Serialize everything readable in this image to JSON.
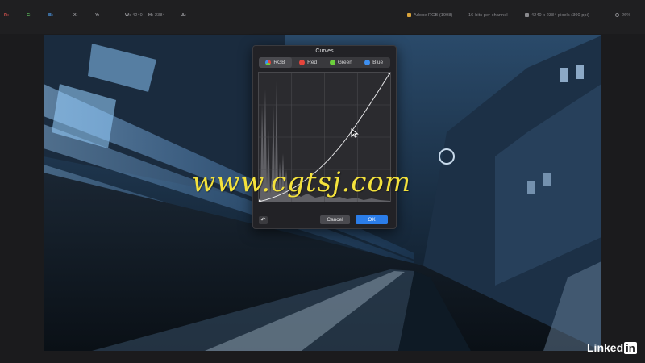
{
  "info_bar": {
    "r_label": "R:",
    "r_value": "-----",
    "g_label": "G:",
    "g_value": "-----",
    "b_label": "B:",
    "b_value": "-----",
    "x_label": "X:",
    "x_value": "-----",
    "y_label": "Y:",
    "y_value": "-----",
    "w_label": "W:",
    "w_value": "4240",
    "h_label": "H:",
    "h_value": "2384",
    "delta_label": "Δ:",
    "delta_value": "-----",
    "color_profile": "Adobe RGB (1998)",
    "bit_depth": "16-bits per channel",
    "dimensions": "4240 x 2384 pixels (300 ppi)",
    "zoom": "26%"
  },
  "curves_dialog": {
    "title": "Curves",
    "tabs": [
      {
        "label": "RGB",
        "color": "rgb-wheel",
        "active": true
      },
      {
        "label": "Red",
        "color": "#e5453c",
        "active": false
      },
      {
        "label": "Green",
        "color": "#6ccf3d",
        "active": false
      },
      {
        "label": "Blue",
        "color": "#3e8ff0",
        "active": false
      }
    ],
    "reset_icon": "undo-icon",
    "cancel_label": "Cancel",
    "ok_label": "OK"
  },
  "watermark": "www.cgtsj.com",
  "brand": {
    "linked": "Linked",
    "in": "in"
  },
  "colors": {
    "accent": "#2b7de9",
    "watermark": "#f4e23c",
    "background": "#1b1b1d"
  }
}
